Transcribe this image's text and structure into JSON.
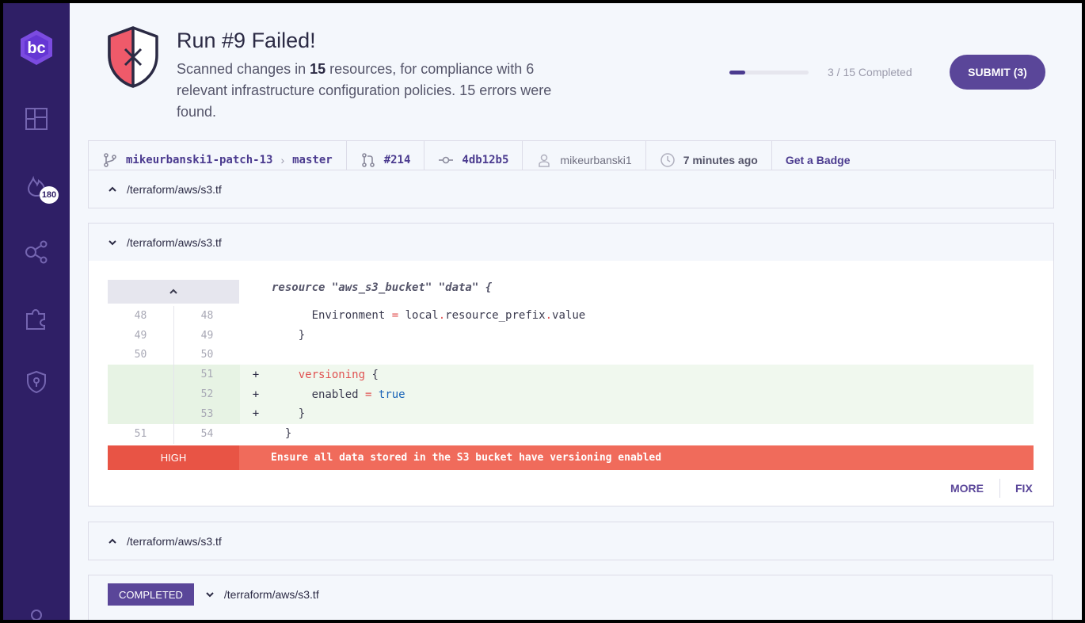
{
  "sidebar": {
    "logo_text": "bc",
    "badge_count": "180",
    "items": [
      {
        "icon": "dashboard-icon"
      },
      {
        "icon": "flame-icon"
      },
      {
        "icon": "share-graph-icon"
      },
      {
        "icon": "puzzle-icon"
      },
      {
        "icon": "shield-icon"
      }
    ]
  },
  "header": {
    "title": "Run #9 Failed!",
    "desc_pre": "Scanned changes in ",
    "desc_count": "15",
    "desc_post": " resources, for compliance with 6 relevant infrastructure configuration policies. 15 errors were found.",
    "progress_fraction": 0.2,
    "progress_text": "3 / 15 Completed",
    "submit_label": "SUBMIT (3)"
  },
  "infobar": {
    "branch": "mikeurbanski1-patch-13",
    "target": "master",
    "pr": "#214",
    "commit": "4db12b5",
    "user": "mikeurbanski1",
    "time": "7 minutes ago",
    "badge_link": "Get a Badge"
  },
  "files": [
    {
      "path": "/terraform/aws/s3.tf",
      "state": "collapsed"
    },
    {
      "path": "/terraform/aws/s3.tf",
      "state": "expanded"
    },
    {
      "path": "/terraform/aws/s3.tf",
      "state": "collapsed"
    },
    {
      "path": "/terraform/aws/s3.tf",
      "state": "expanded",
      "badge": "COMPLETED"
    }
  ],
  "code": {
    "header": "resource \"aws_s3_bucket\" \"data\" {",
    "rows": [
      {
        "l1": "48",
        "l2": "48",
        "mark": "",
        "type": "ctx"
      },
      {
        "l1": "49",
        "l2": "49",
        "mark": "",
        "type": "ctx",
        "text": "    }"
      },
      {
        "l1": "50",
        "l2": "50",
        "mark": "",
        "type": "ctx",
        "text": ""
      },
      {
        "l1": "",
        "l2": "51",
        "mark": "+",
        "type": "add"
      },
      {
        "l1": "",
        "l2": "52",
        "mark": "+",
        "type": "add"
      },
      {
        "l1": "",
        "l2": "53",
        "mark": "+",
        "type": "add",
        "text": "    }"
      },
      {
        "l1": "51",
        "l2": "54",
        "mark": "",
        "type": "ctx",
        "text": "  }"
      }
    ],
    "line48": {
      "a": "      Environment ",
      "op": "=",
      "b": " local",
      "dot": ".",
      "c": "resource_prefix",
      "dot2": ".",
      "d": "value"
    },
    "line51": {
      "pre": "    ",
      "kw": "versioning",
      "post": " {"
    },
    "line52": {
      "pre": "      enabled ",
      "op": "=",
      "sp": " ",
      "val": "true"
    },
    "severity": "HIGH",
    "message": "Ensure all data stored in the S3 bucket have versioning enabled",
    "more_label": "MORE",
    "fix_label": "FIX"
  },
  "colors": {
    "sidebar": "#2f1f66",
    "accent": "#5a4699",
    "danger": "#f06b5b"
  }
}
